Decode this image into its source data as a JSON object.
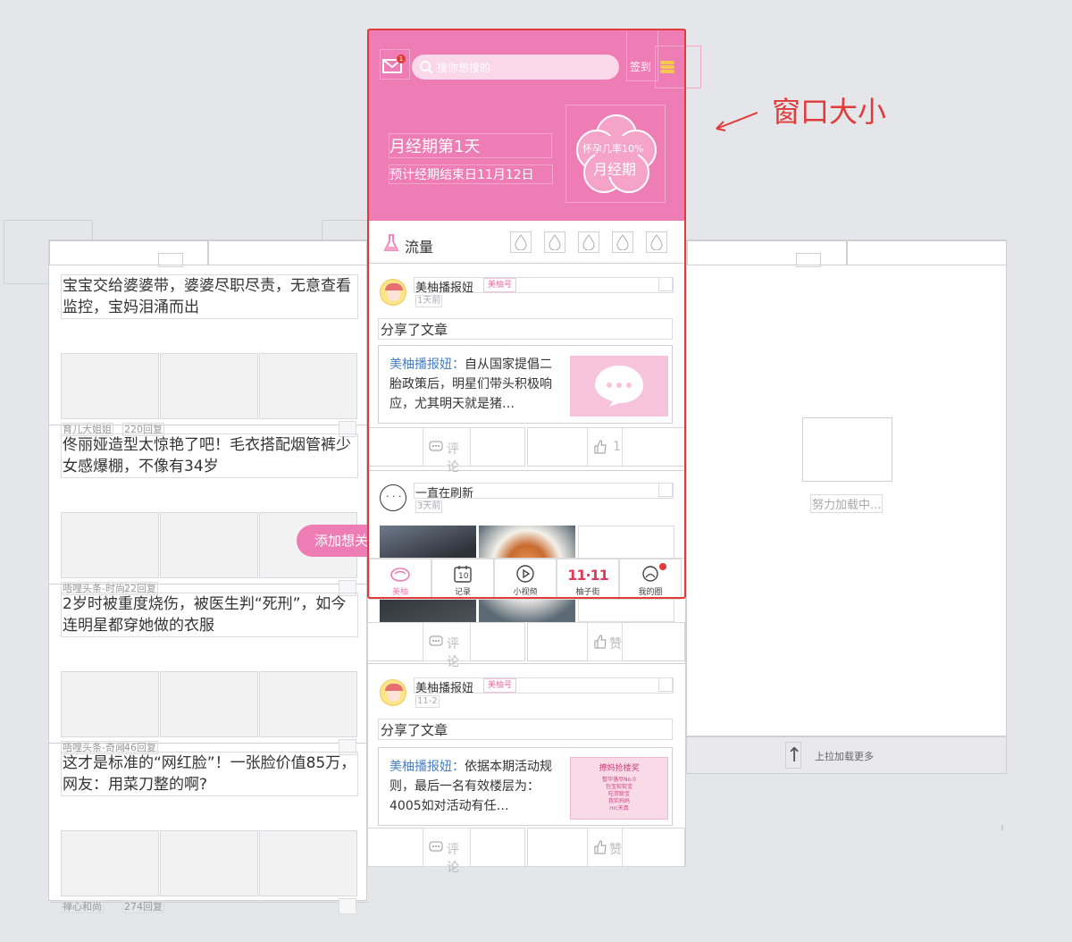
{
  "annotation": {
    "text": "窗口大小",
    "color": "#e03a3a"
  },
  "header": {
    "search_placeholder": "搜你想搜的",
    "mail_badge": "1",
    "signin_label": "签到",
    "cycle_title": "月经期第1天",
    "cycle_sub": "预计经期结束日11月12日",
    "flower_top": "怀孕几率10%",
    "flower_main": "月经期",
    "accent": "#ee7cb5"
  },
  "flow": {
    "label": "流量"
  },
  "posts": [
    {
      "author": "美柚播报妞",
      "tag": "美柚号",
      "time": "1天前",
      "share": "分享了文章",
      "article_author": "美柚播报妞：",
      "article_text": "自从国家提倡二胎政策后，明星们带头积极响应，尤其明天就是猪…",
      "comment": "评论",
      "like": "1"
    },
    {
      "author": "一直在刷新",
      "time": "3天前",
      "comment": "评论",
      "like": "赞"
    },
    {
      "author": "美柚播报妞",
      "tag": "美柚号",
      "time": "11-2",
      "share": "分享了文章",
      "article_author": "美柚播报妞：",
      "article_text": "依据本期活动规则，最后一名有效楼层为：4005如对活动有任…",
      "poster_title": "撩妈抢楼奖",
      "poster_lines": [
        "整华落尽No.0",
        "包宝软软宝",
        "吃货聪宝",
        "我实妈妈",
        "rnc天真"
      ],
      "comment": "评论",
      "like": "赞"
    }
  ],
  "tabs": [
    {
      "label": "美柚",
      "icon": "meiyou-icon"
    },
    {
      "label": "记录",
      "icon": "calendar-icon"
    },
    {
      "label": "小视频",
      "icon": "play-icon"
    },
    {
      "label": "柚子街",
      "icon": "double-eleven-icon"
    },
    {
      "label": "我的圈",
      "icon": "my-circle-icon"
    }
  ],
  "calendar_day": "10",
  "add_interest": "添加想关",
  "left_feed": [
    {
      "title": "宝宝交给婆婆带，婆婆尽职尽责，无意查看监控，宝妈泪涌而出",
      "source": "育儿大姐姐",
      "count": "220回复"
    },
    {
      "title": "佟丽娅造型太惊艳了吧！毛衣搭配烟管裤少女感爆棚，不像有34岁",
      "source": "唔哩头条-时尚",
      "count": "22回复"
    },
    {
      "title": "2岁时被重度烧伤，被医生判“死刑”，如今连明星都穿她做的衣服",
      "source": "唔哩头条-奇闻",
      "count": "46回复"
    },
    {
      "title": "这才是标准的“网红脸”！一张脸价值85万，网友：用菜刀整的啊?",
      "source": "禅心和尚",
      "count": "274回复"
    }
  ],
  "right": {
    "loading": "努力加载中...",
    "pull_more": "上拉加载更多"
  }
}
